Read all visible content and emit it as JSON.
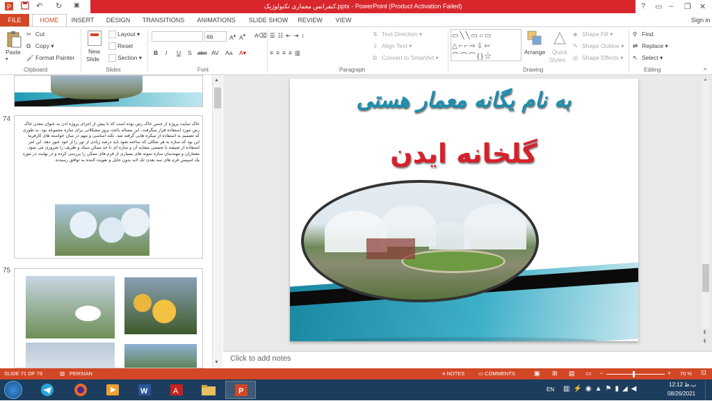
{
  "window": {
    "title": "کنفرانس معماری تکنولوژیک.pptx -  PowerPoint (Product Activation Failed)",
    "help": "?",
    "signin": "Sign in"
  },
  "tabs": [
    "FILE",
    "HOME",
    "INSERT",
    "DESIGN",
    "TRANSITIONS",
    "ANIMATIONS",
    "SLIDE SHOW",
    "REVIEW",
    "VIEW"
  ],
  "ribbon": {
    "clipboard": {
      "paste": "Paste",
      "cut": "Cut",
      "copy": "Copy",
      "format_painter": "Format Painter",
      "group": "Clipboard"
    },
    "slides": {
      "new_slide_line1": "New",
      "new_slide_line2": "Slide",
      "layout": "Layout",
      "reset": "Reset",
      "section": "Section",
      "group": "Slides"
    },
    "font": {
      "size": "66",
      "group": "Font"
    },
    "paragraph": {
      "text_direction": "Text Direction",
      "align_text": "Align Text",
      "convert": "Convert to SmartArt",
      "group": "Paragraph"
    },
    "drawing": {
      "arrange": "Arrange",
      "quick_styles_1": "Quick",
      "quick_styles_2": "Styles",
      "shape_fill": "Shape Fill",
      "shape_outline": "Shape Outline",
      "shape_effects": "Shape Effects",
      "group": "Drawing"
    },
    "editing": {
      "find": "Find",
      "replace": "Replace",
      "select": "Select",
      "group": "Editing"
    }
  },
  "thumbnails": {
    "n74": "74",
    "n75": "75",
    "slide74_text": "خاک سایت پروژه از جنس خاک رس بوده است که تا پیش از اجرای پروژه ادن به عنوان معدن خاک رس مورد استفاده قرار میگرفت. این مساله باعث بروز مشکلاتی برای سازه مجموعه بود. به طوری که تصمیم به استفاده از تیبکره هایی گرفته شد. تکنه اساسی و مهم در میان خواسته های کارفرما این بود که سازه به هر شکلی که ساخته شود باید درصد زیادی از نور را از خود عبور دهد. این امر استفاده از شیشه یا جسمی مشابه آن و سازه ای تا حد ممکن سبک و ظریف را ضروری می نمود. معماران و مهندسان سازه نمونه های بسیاری از فرم های ممکن را بررسی کرده و در نهایت در مورد یک اسپیس فرم های سه بعدی تک لایه بدون حایل و تقویت کننده به توافق رسیدند."
  },
  "slide": {
    "title": "به نام یگانه معمار هستی",
    "subtitle": "گلخانه ایدن"
  },
  "notes": {
    "placeholder": "Click to add notes"
  },
  "status": {
    "slide": "SLIDE 71 OF 79",
    "language": "PERSIAN",
    "notes": "NOTES",
    "comments": "COMMENTS",
    "zoom": "70 %"
  },
  "taskbar": {
    "lang": "EN",
    "time": "12:12 ب.ظ",
    "date": "08/26/2021"
  },
  "colors": {
    "accent": "#d24726",
    "titlebar_red": "#d9262c",
    "taskbar": "#1d3d5e",
    "slide_title": "#1a8fb0",
    "slide_subtitle": "#d8202a"
  }
}
